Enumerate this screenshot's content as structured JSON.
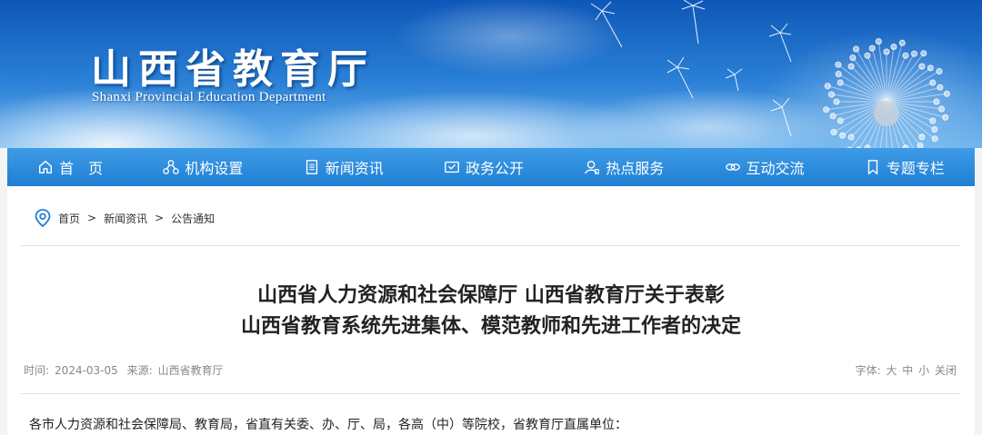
{
  "site": {
    "name_cn": "山西省教育厅",
    "name_en": "Shanxi Provincial Education Department"
  },
  "nav": {
    "items": [
      {
        "label": "首　页",
        "icon": "home-icon"
      },
      {
        "label": "机构设置",
        "icon": "org-icon"
      },
      {
        "label": "新闻资讯",
        "icon": "document-icon"
      },
      {
        "label": "政务公开",
        "icon": "open-icon"
      },
      {
        "label": "热点服务",
        "icon": "user-service-icon"
      },
      {
        "label": "互动交流",
        "icon": "link-icon"
      },
      {
        "label": "专题专栏",
        "icon": "bookmark-icon"
      }
    ]
  },
  "breadcrumb": {
    "icon": "location-pin-icon",
    "items": [
      "首页",
      "新闻资讯",
      "公告通知"
    ],
    "separator": ">"
  },
  "article": {
    "title_line1": "山西省人力资源和社会保障厅 山西省教育厅关于表彰",
    "title_line2": "山西省教育系统先进集体、模范教师和先进工作者的决定",
    "time_label": "时间:",
    "time": "2024-03-05",
    "source_label": "来源:",
    "source": "山西省教育厅",
    "font_label": "字体:",
    "font_large": "大",
    "font_medium": "中",
    "font_small": "小",
    "close": "关闭",
    "first_line": "各市人力资源和社会保障局、教育局，省直有关委、办、厅、局，各高（中）等院校，省教育厅直属单位："
  },
  "colors": {
    "nav_bg": "#2a8ae0",
    "accent": "#1f7fd4",
    "breadcrumb_icon": "#1f7fd4"
  }
}
